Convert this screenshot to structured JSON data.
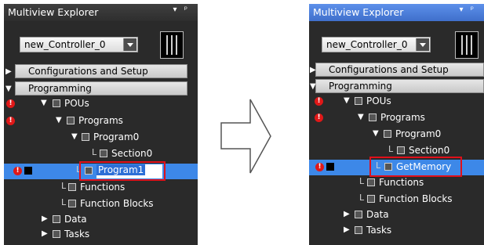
{
  "left": {
    "title": "Multiview Explorer",
    "pin": "▾ ᵖ",
    "controller": "new_Controller_0",
    "sections": [
      "Configurations and Setup",
      "Programming"
    ],
    "tree": {
      "pous": "POUs",
      "programs": "Programs",
      "program0": "Program0",
      "section0": "Section0",
      "program1_edit": "Program1",
      "functions": "Functions",
      "function_blocks": "Function Blocks",
      "data": "Data",
      "tasks": "Tasks"
    }
  },
  "right": {
    "title": "Multiview Explorer",
    "pin": "▾ ᵖ",
    "controller": "new_Controller_0",
    "sections": [
      "Configurations and Setup",
      "Programming"
    ],
    "tree": {
      "pous": "POUs",
      "programs": "Programs",
      "program0": "Program0",
      "section0": "Section0",
      "getmemory": "GetMemory",
      "functions": "Functions",
      "function_blocks": "Function Blocks",
      "data": "Data",
      "tasks": "Tasks"
    }
  },
  "icons": {
    "error": "!",
    "expand": "▼",
    "collapse": "▶"
  }
}
